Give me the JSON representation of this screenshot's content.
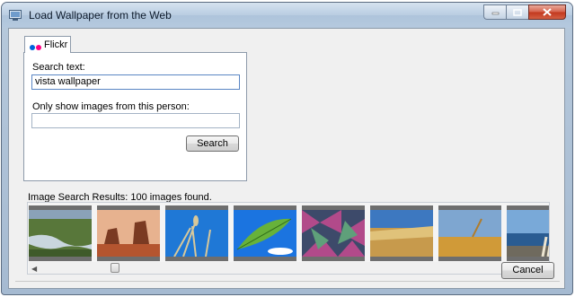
{
  "window": {
    "title": "Load Wallpaper from the Web",
    "icon": "app-window-icon"
  },
  "tabs": [
    {
      "label": "Flickr",
      "icon": "flickr-logo-icon",
      "colors": [
        "#0063dc",
        "#ff0084"
      ]
    }
  ],
  "search": {
    "text_label": "Search text:",
    "text_value": "vista wallpaper",
    "person_label": "Only show images from this person:",
    "person_value": "",
    "button_label": "Search"
  },
  "results": {
    "label": "Image Search Results: 100 images found.",
    "thumbnails": [
      {
        "name": "river-landscape",
        "icon": "thumbnail-image"
      },
      {
        "name": "desert-butte",
        "icon": "thumbnail-image"
      },
      {
        "name": "grass-blue-sky",
        "icon": "thumbnail-image"
      },
      {
        "name": "green-leaf-sky",
        "icon": "thumbnail-image"
      },
      {
        "name": "abstract-mosaic",
        "icon": "thumbnail-image"
      },
      {
        "name": "wheat-field",
        "icon": "thumbnail-image"
      },
      {
        "name": "golden-grass",
        "icon": "thumbnail-image"
      },
      {
        "name": "ocean-pampas",
        "icon": "thumbnail-image"
      }
    ]
  },
  "footer": {
    "cancel_label": "Cancel"
  },
  "colors": {
    "accent": "#5a86c4",
    "titlebar": "#b9cde2",
    "close": "#c2371d"
  }
}
